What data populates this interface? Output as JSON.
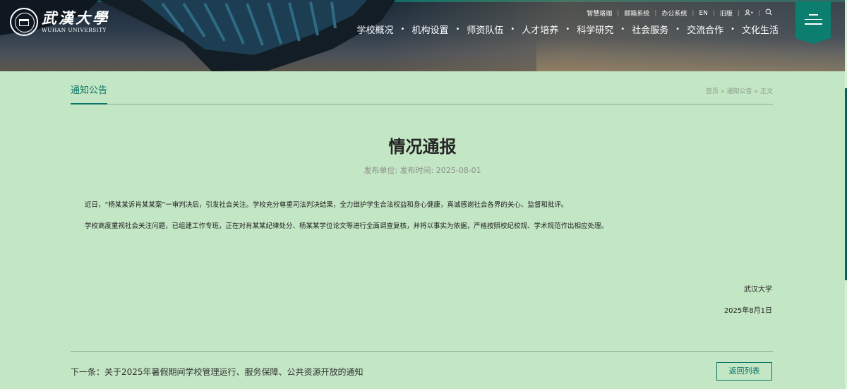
{
  "header": {
    "logo_cn": "武漢大學",
    "logo_en": "WUHAN UNIVERSITY",
    "utility": [
      "智慧珞珈",
      "邮箱系统",
      "办公系统",
      "EN",
      "旧版"
    ],
    "nav": [
      "学校概况",
      "机构设置",
      "师资队伍",
      "人才培养",
      "科学研究",
      "社会服务",
      "交流合作",
      "文化生活"
    ],
    "icons": {
      "user": "user-icon",
      "search": "search-icon",
      "menu": "menu-icon"
    },
    "accent_color": "#0c7e70"
  },
  "section": {
    "title": "通知公告",
    "breadcrumb": [
      "首页",
      "通知公告",
      "正文"
    ],
    "breadcrumb_sep": "»"
  },
  "article": {
    "title": "情况通报",
    "meta": "发布单位:  发布时间:  2025-08-01",
    "paragraphs": [
      "近日，“杨某某诉肖某某案”一审判决后，引发社会关注。学校充分尊重司法判决结果，全力维护学生合法权益和身心健康，真诚感谢社会各界的关心、监督和批评。",
      "学校高度重视社会关注问题，已组建工作专班，正在对肖某某纪律处分、杨某某学位论文等进行全面调查复核，并将以事实为依据，严格按照校纪校规、学术规范作出相应处理。"
    ],
    "signature": "武汉大学",
    "date": "2025年8月1日"
  },
  "footer": {
    "next": "下一条：关于2025年暑假期间学校管理运行、服务保障、公共资源开放的通知",
    "back_label": "返回列表"
  }
}
